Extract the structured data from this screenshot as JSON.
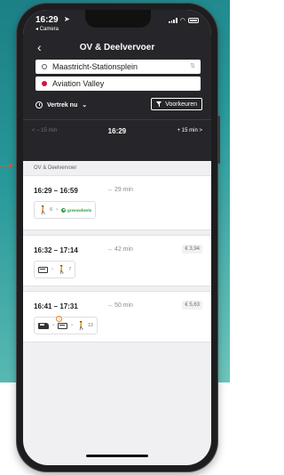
{
  "status_bar": {
    "time": "16:29",
    "back_app": "◂ Camera"
  },
  "nav": {
    "title": "OV & Deelvervoer"
  },
  "search": {
    "from": "Maastricht-Stationsplein",
    "to": "Aviation Valley"
  },
  "options": {
    "departure_label": "Vertrek nu",
    "preferences_label": "Voorkeuren"
  },
  "time_nav": {
    "prev": "< – 15 min",
    "current": "16:29",
    "next": "+ 15 min >"
  },
  "results": {
    "section_label": "OV & Deelvervoer",
    "items": [
      {
        "times": "16:29 – 16:59",
        "duration": "→ 29 min",
        "price": "",
        "legs": [
          {
            "icon": "walk-icon",
            "count": "6"
          },
          {
            "icon": "greenwheels-icon",
            "label": "greenwheels"
          }
        ]
      },
      {
        "times": "16:32 – 17:14",
        "duration": "→ 42 min",
        "price": "€ 3,94",
        "legs": [
          {
            "icon": "bus-icon",
            "count": ""
          },
          {
            "icon": "walk-icon",
            "count": "7"
          }
        ]
      },
      {
        "times": "16:41 – 17:31",
        "duration": "→ 50 min",
        "price": "€ 5,63",
        "legs": [
          {
            "icon": "train-icon",
            "count": ""
          },
          {
            "icon": "bus-icon",
            "count": "",
            "warning": true
          },
          {
            "icon": "walk-icon",
            "count": "13"
          }
        ]
      }
    ]
  },
  "colors": {
    "header_bg": "#26262a",
    "destination_dot": "#d1124a",
    "greenwheels": "#2c9a3f",
    "background_teal": "#28999a",
    "arrow": "#e8532e"
  }
}
